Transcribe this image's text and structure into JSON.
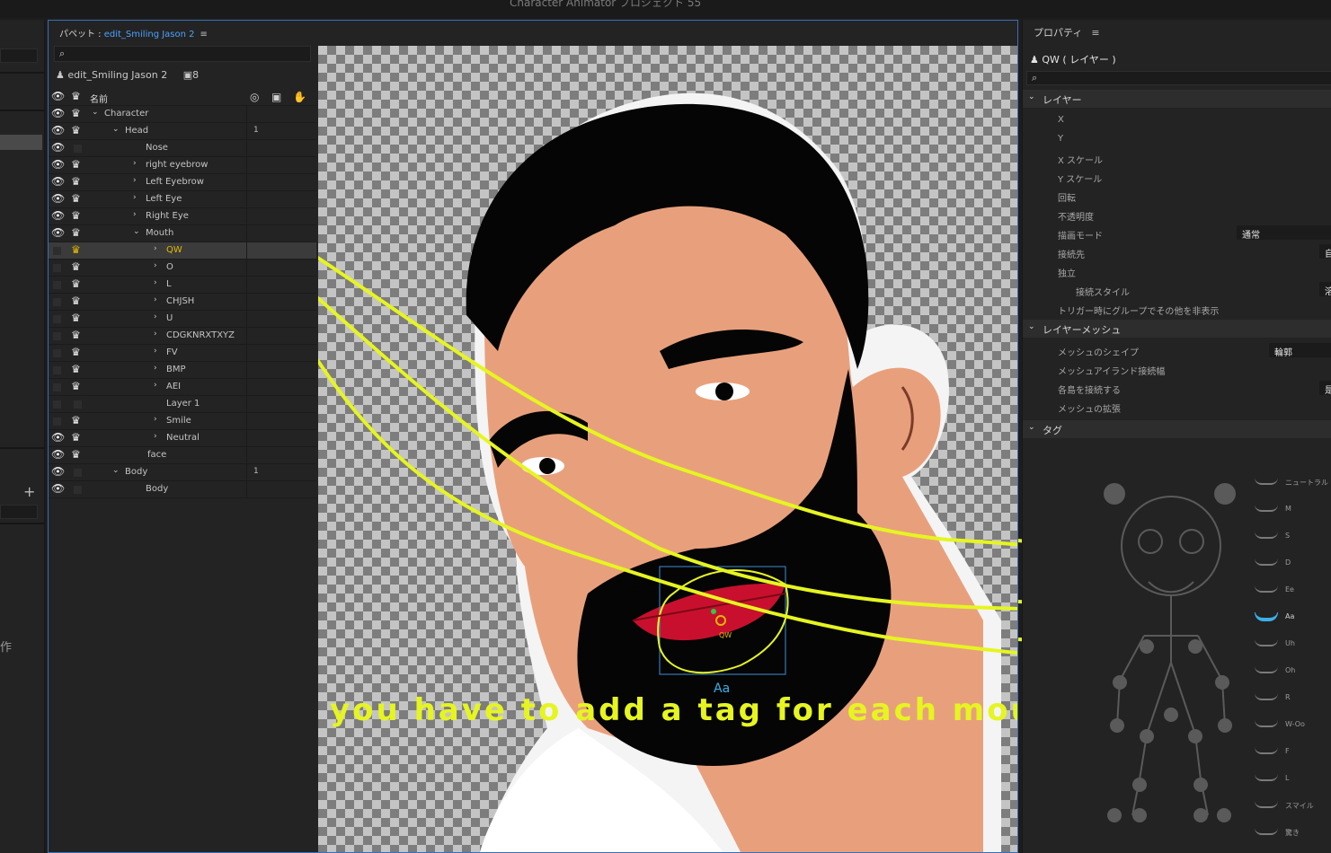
{
  "window": {
    "title": "Character Animator プロジェクト 55"
  },
  "left_strip": {
    "partial_text": "作"
  },
  "puppet_panel": {
    "title_prefix": "パペット : ",
    "puppet_name": "edit_Smiling Jason 2",
    "menu_glyph": "≡",
    "info_name": "edit_Smiling Jason 2",
    "info_count": "8",
    "header_label": "名前",
    "layers": [
      {
        "label": "Character",
        "num": ""
      },
      {
        "label": "Head",
        "num": "1"
      },
      {
        "label": "Nose",
        "num": ""
      },
      {
        "label": "right eyebrow",
        "num": ""
      },
      {
        "label": "Left Eyebrow",
        "num": ""
      },
      {
        "label": "Left Eye",
        "num": ""
      },
      {
        "label": "Right Eye",
        "num": ""
      },
      {
        "label": "Mouth",
        "num": ""
      },
      {
        "label": "QW",
        "num": ""
      },
      {
        "label": "O",
        "num": ""
      },
      {
        "label": "L",
        "num": ""
      },
      {
        "label": "CHJSH",
        "num": ""
      },
      {
        "label": "U",
        "num": ""
      },
      {
        "label": "CDGKNRXTXYZ",
        "num": ""
      },
      {
        "label": "FV",
        "num": ""
      },
      {
        "label": "BMP",
        "num": ""
      },
      {
        "label": "AEI",
        "num": ""
      },
      {
        "label": "Layer 1",
        "num": ""
      },
      {
        "label": "Smile",
        "num": ""
      },
      {
        "label": "Neutral",
        "num": ""
      },
      {
        "label": "face",
        "num": ""
      },
      {
        "label": "Body",
        "num": "1"
      },
      {
        "label": "Body",
        "num": ""
      }
    ]
  },
  "canvas": {
    "caption": "you have to add a tag for each mouth shape.",
    "pin_label": "QW",
    "partial_tag_label": "Aa",
    "colors": {
      "skin": "#e8a07c",
      "beard": "#050505",
      "lips": "#c8102e",
      "annotation": "#e6f520",
      "selection": "#3a8fd8"
    }
  },
  "properties": {
    "title": "プロパティ",
    "menu_glyph": "≡",
    "layer_name": "QW ( レイヤー )",
    "sections": {
      "layer": "レイヤー",
      "layer_mesh": "レイヤーメッシュ",
      "tags": "タグ"
    },
    "layer_props": [
      "X",
      "Y",
      "X スケール",
      "Y スケール",
      "回転",
      "不透明度",
      "描画モード",
      "接続先",
      "独立",
      "接続スタイル",
      "トリガー時にグループでその他を非表示"
    ],
    "blend_mode_value": "通常",
    "attach_value_partial": "自",
    "attach_style_value_partial": "溶",
    "mesh_props": [
      "メッシュのシェイプ",
      "メッシュアイランド接続幅",
      "各島を接続する",
      "メッシュの拡張"
    ],
    "mesh_shape_value": "輪郭",
    "connect_value_partial": "是",
    "tags": [
      "ニュートラル",
      "M",
      "S",
      "D",
      "Ee",
      "Aa",
      "Uh",
      "Oh",
      "R",
      "W-Oo",
      "F",
      "L",
      "スマイル",
      "驚き"
    ],
    "active_tag": "Aa"
  }
}
